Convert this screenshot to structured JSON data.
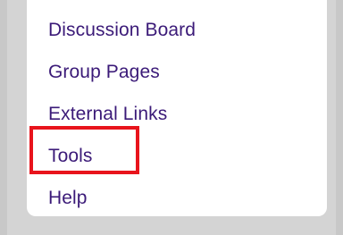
{
  "menu": {
    "items": [
      {
        "label": "Discussion Board"
      },
      {
        "label": "Group Pages"
      },
      {
        "label": "External Links"
      },
      {
        "label": "Tools"
      },
      {
        "label": "Help"
      }
    ]
  },
  "colors": {
    "link": "#3b1a78",
    "highlight_border": "#e8141c",
    "panel": "#ffffff",
    "background": "#d4d4d4"
  }
}
